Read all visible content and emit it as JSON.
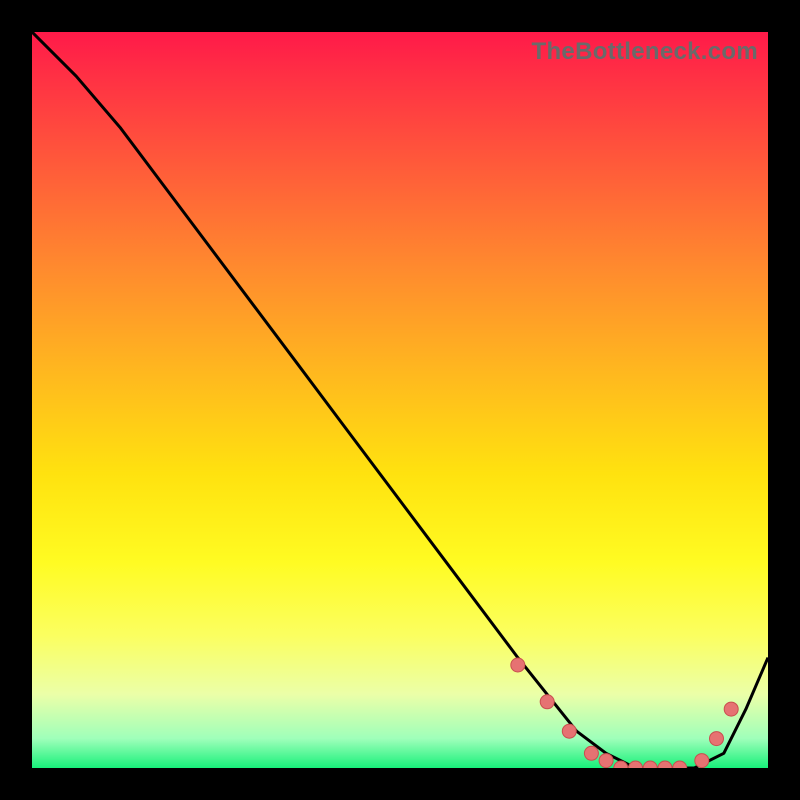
{
  "watermark": "TheBottleneck.com",
  "colors": {
    "curve": "#000000",
    "dot_fill": "#e67272",
    "dot_stroke": "#c94f4f"
  },
  "chart_data": {
    "type": "line",
    "title": "",
    "xlabel": "",
    "ylabel": "",
    "xlim": [
      0,
      100
    ],
    "ylim": [
      0,
      100
    ],
    "grid": false,
    "series": [
      {
        "name": "bottleneck-curve",
        "x": [
          0,
          6,
          12,
          18,
          24,
          30,
          36,
          42,
          48,
          54,
          60,
          66,
          70,
          74,
          78,
          82,
          86,
          90,
          94,
          97,
          100
        ],
        "y": [
          100,
          94,
          87,
          79,
          71,
          63,
          55,
          47,
          39,
          31,
          23,
          15,
          10,
          5,
          2,
          0,
          0,
          0,
          2,
          8,
          15
        ]
      }
    ],
    "markers": {
      "name": "highlighted-points",
      "x": [
        66,
        70,
        73,
        76,
        78,
        80,
        82,
        84,
        86,
        88,
        91,
        93,
        95
      ],
      "y": [
        14,
        9,
        5,
        2,
        1,
        0,
        0,
        0,
        0,
        0,
        1,
        4,
        8
      ]
    }
  }
}
